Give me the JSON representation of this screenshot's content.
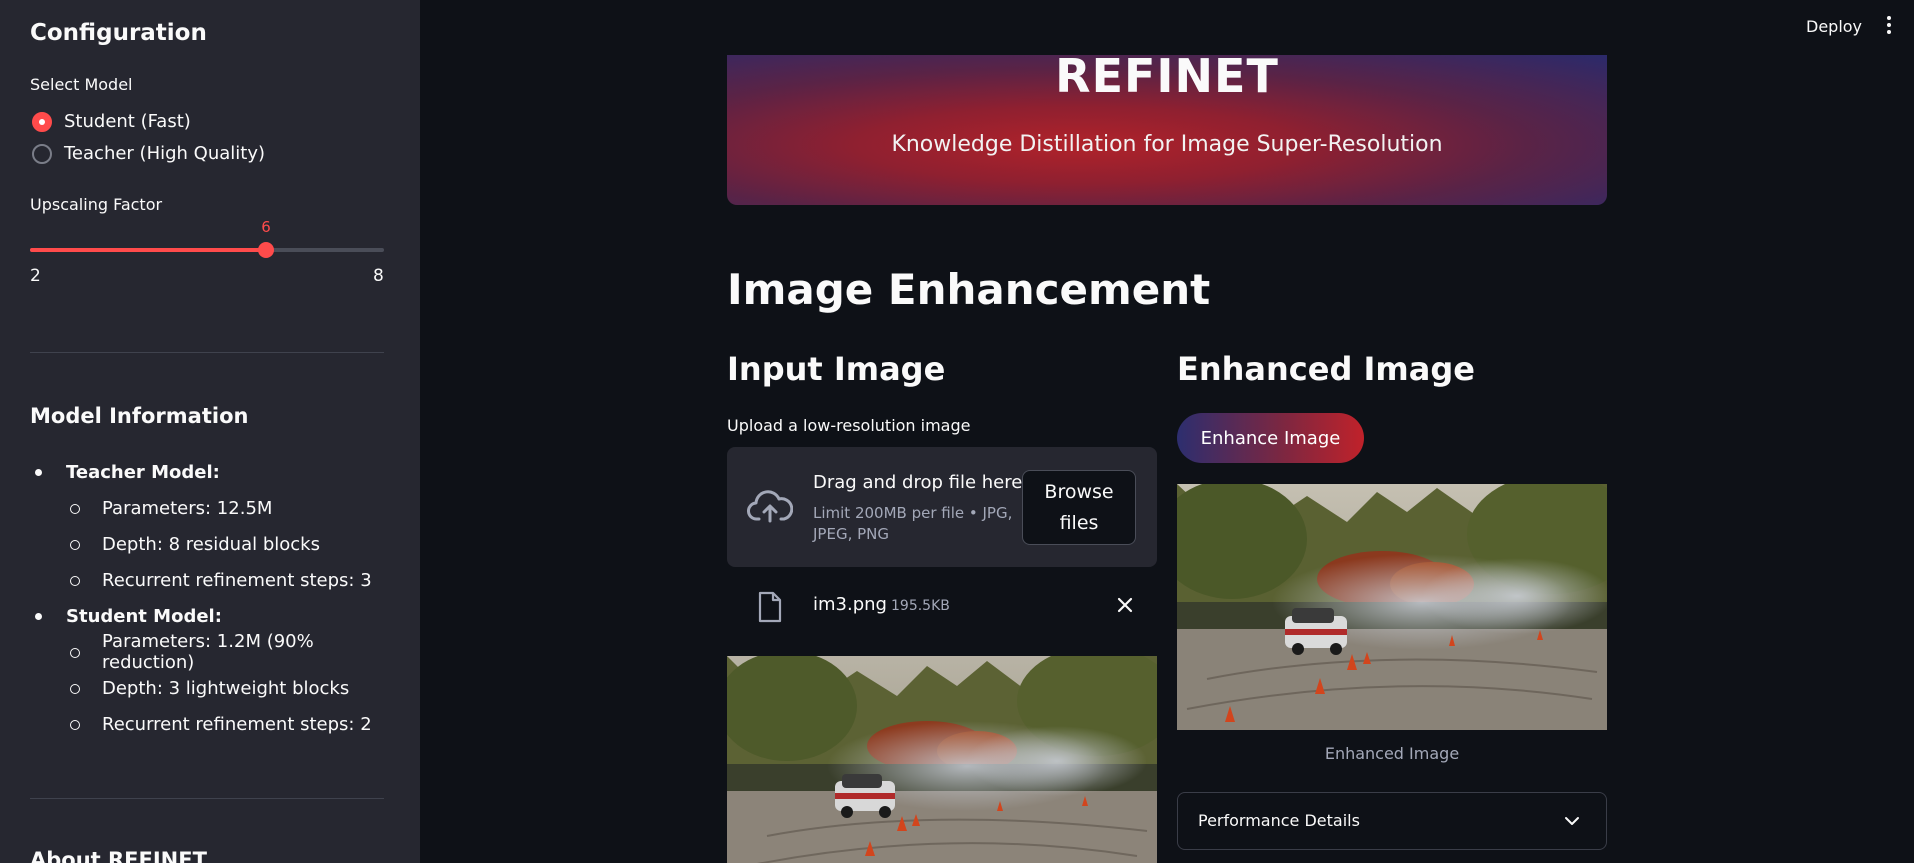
{
  "header": {
    "deploy_label": "Deploy"
  },
  "sidebar": {
    "title": "Configuration",
    "select_model_label": "Select Model",
    "model_options": [
      {
        "label": "Student (Fast)",
        "selected": true
      },
      {
        "label": "Teacher (High Quality)",
        "selected": false
      }
    ],
    "upscaling": {
      "label": "Upscaling Factor",
      "value": "6",
      "min": "2",
      "max": "8"
    },
    "model_info_title": "Model Information",
    "teacher": {
      "title": "Teacher Model:",
      "items": [
        "Parameters: 12.5M",
        "Depth: 8 residual blocks",
        "Recurrent refinement steps: 3"
      ]
    },
    "student": {
      "title": "Student Model:",
      "items": [
        "Parameters: 1.2M (90% reduction)",
        "Depth: 3 lightweight blocks",
        "Recurrent refinement steps: 2"
      ]
    },
    "about_title": "About REFINET"
  },
  "banner": {
    "title": "REFINET",
    "subtitle": "Knowledge Distillation for Image Super-Resolution"
  },
  "main": {
    "heading": "Image Enhancement",
    "input": {
      "heading": "Input Image",
      "upload_label": "Upload a low-resolution image",
      "drop_text": "Drag and drop file here",
      "limit_text": "Limit 200MB per file • JPG, JPEG, PNG",
      "browse_label": "Browse files",
      "file_name": "im3.png",
      "file_size": "195.5KB"
    },
    "output": {
      "heading": "Enhanced Image",
      "enhance_button": "Enhance Image",
      "caption": "Enhanced Image",
      "performance_label": "Performance Details"
    }
  },
  "colors": {
    "accent": "#ff4b4b",
    "background": "#0e1117",
    "sidebar": "#262730"
  }
}
